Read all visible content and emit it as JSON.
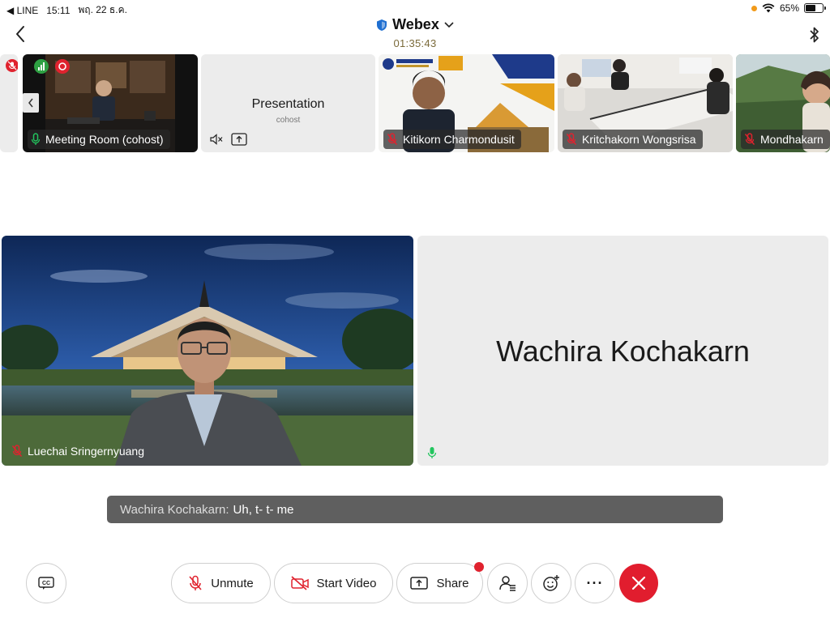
{
  "status_bar": {
    "back_app": "◀ LINE",
    "time": "15:11",
    "date": "พฤ. 22 ธ.ค.",
    "battery_percent": "65%",
    "battery_level": 0.65
  },
  "header": {
    "title": "Webex",
    "timer": "01:35:43"
  },
  "thumbnails": [
    {
      "name": "Meeting Room (cohost)",
      "mic": "on"
    },
    {
      "name": "Presentation",
      "subtitle": "cohost"
    },
    {
      "name": "Kitikorn Charmondusit",
      "mic": "muted"
    },
    {
      "name": "Kritchakorn Wongsrisa",
      "mic": "muted"
    },
    {
      "name": "Mondhakarn",
      "mic": "muted"
    }
  ],
  "main": {
    "left_participant": "Luechai Sringernyuang",
    "right_participant": "Wachira Kochakarn"
  },
  "caption": {
    "speaker": "Wachira Kochakarn:",
    "text": "Uh, t- t- me"
  },
  "controls": {
    "unmute_label": "Unmute",
    "start_video_label": "Start Video",
    "share_label": "Share",
    "more_label": "···"
  },
  "colors": {
    "end_call": "#e11d2e",
    "muted_mic": "#e0222e",
    "active_mic": "#22c55e",
    "caption_bg": "#5f5f5f"
  }
}
